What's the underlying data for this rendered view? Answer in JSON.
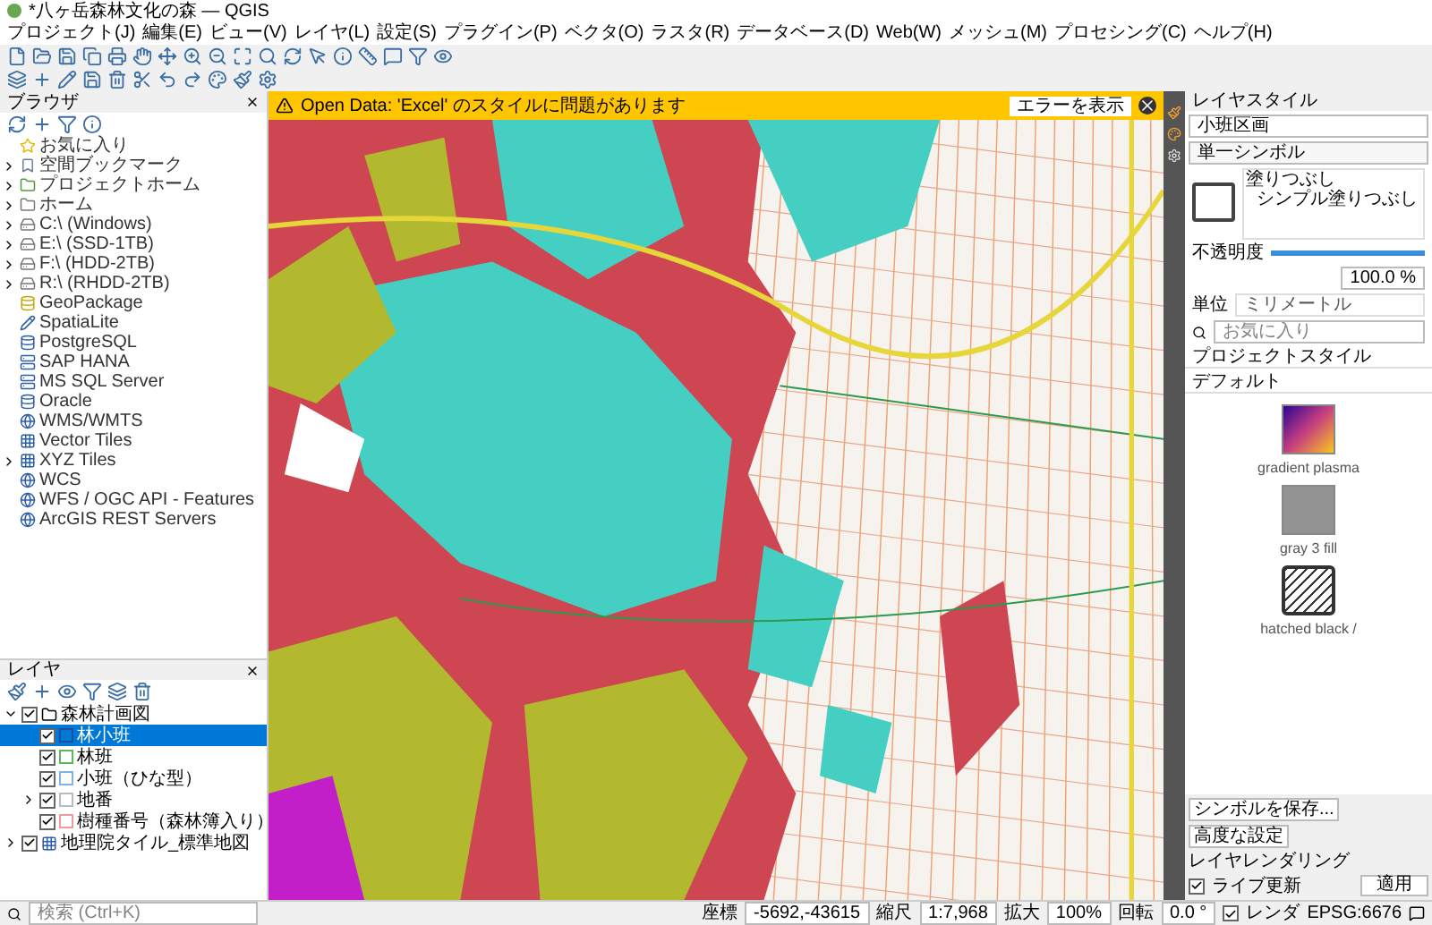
{
  "window": {
    "title": "*八ヶ岳森林文化の森 — QGIS"
  },
  "menu": [
    "プロジェクト(J)",
    "編集(E)",
    "ビュー(V)",
    "レイヤ(L)",
    "設定(S)",
    "プラグイン(P)",
    "ベクタ(O)",
    "ラスタ(R)",
    "データベース(D)",
    "Web(W)",
    "メッシュ(M)",
    "プロセシング(C)",
    "ヘルプ(H)"
  ],
  "browser": {
    "title": "ブラウザ",
    "items": [
      {
        "label": "お気に入り"
      },
      {
        "label": "空間ブックマーク",
        "expanded": false
      },
      {
        "label": "プロジェクトホーム",
        "expanded": false
      },
      {
        "label": "ホーム",
        "expanded": false
      },
      {
        "label": "C:\\ (Windows)",
        "expanded": false
      },
      {
        "label": "E:\\ (SSD-1TB)",
        "expanded": false
      },
      {
        "label": "F:\\ (HDD-2TB)",
        "expanded": false
      },
      {
        "label": "R:\\ (RHDD-2TB)",
        "expanded": false
      },
      {
        "label": "GeoPackage"
      },
      {
        "label": "SpatiaLite"
      },
      {
        "label": "PostgreSQL"
      },
      {
        "label": "SAP HANA"
      },
      {
        "label": "MS SQL Server"
      },
      {
        "label": "Oracle"
      },
      {
        "label": "WMS/WMTS"
      },
      {
        "label": "Vector Tiles"
      },
      {
        "label": "XYZ Tiles",
        "expanded": false
      },
      {
        "label": "WCS"
      },
      {
        "label": "WFS / OGC API - Features"
      },
      {
        "label": "ArcGIS REST Servers"
      }
    ]
  },
  "layers": {
    "title": "レイヤ",
    "items": [
      {
        "label": "森林計画図",
        "checked": true,
        "selected": false,
        "kind": "group",
        "expanded": true,
        "children": [
          {
            "label": "林小班",
            "checked": true,
            "selected": true,
            "kind": "polygon",
            "color": "#1f4e9c"
          },
          {
            "label": "林班",
            "checked": true,
            "selected": false,
            "kind": "polygon",
            "color": "#5cb85c"
          },
          {
            "label": "小班（ひな型）",
            "checked": true,
            "selected": false,
            "kind": "polygon",
            "color": "#7fb2e5"
          },
          {
            "label": "地番",
            "checked": true,
            "selected": false,
            "kind": "polygon",
            "color": "#bbbbbb",
            "expanded": false
          },
          {
            "label": "樹種番号（森林簿入り）",
            "checked": true,
            "selected": false,
            "kind": "polygon",
            "color": "#f29a9a"
          }
        ]
      },
      {
        "label": "地理院タイル_標準地図",
        "checked": true,
        "selected": false,
        "kind": "raster",
        "expanded": false
      }
    ]
  },
  "banner": {
    "message": "Open Data: 'Excel' のスタイルに問題があります",
    "button": "エラーを表示"
  },
  "style_panel": {
    "title": "レイヤスタイル",
    "layer": "小班区画",
    "renderer": "単一シンボル",
    "tree": [
      "塗りつぶし",
      "シンプル塗りつぶし"
    ],
    "opacity_label": "不透明度",
    "opacity": {
      "level": 1
    },
    "opacity_value": "100.0 %",
    "unit_label": "単位",
    "unit": "ミリメートル",
    "search_placeholder": "お気に入り",
    "section": "プロジェクトスタイル",
    "subsection": "デフォルト",
    "symbols": [
      {
        "name": "gradient plasma",
        "kind": "gradient"
      },
      {
        "name": "gray 3 fill",
        "kind": "gray"
      },
      {
        "name": "hatched black /",
        "kind": "hatch"
      }
    ],
    "buttons": [
      "シンボルを保存...",
      "高度な設定"
    ],
    "rendering": "レイヤレンダリング",
    "live_update": {
      "label": "ライブ更新",
      "checked": true
    },
    "apply": "適用"
  },
  "status": {
    "search_placeholder": "検索 (Ctrl+K)",
    "coord_label": "座標",
    "coord": "-5692,-43615",
    "scale_label": "縮尺",
    "scale": "1:7,968",
    "zoom_label": "拡大",
    "zoom": "100%",
    "rotation_label": "回転",
    "rotation": "0.0 °",
    "render": {
      "label": "レンダ",
      "checked": true
    },
    "crs": "EPSG:6676"
  }
}
